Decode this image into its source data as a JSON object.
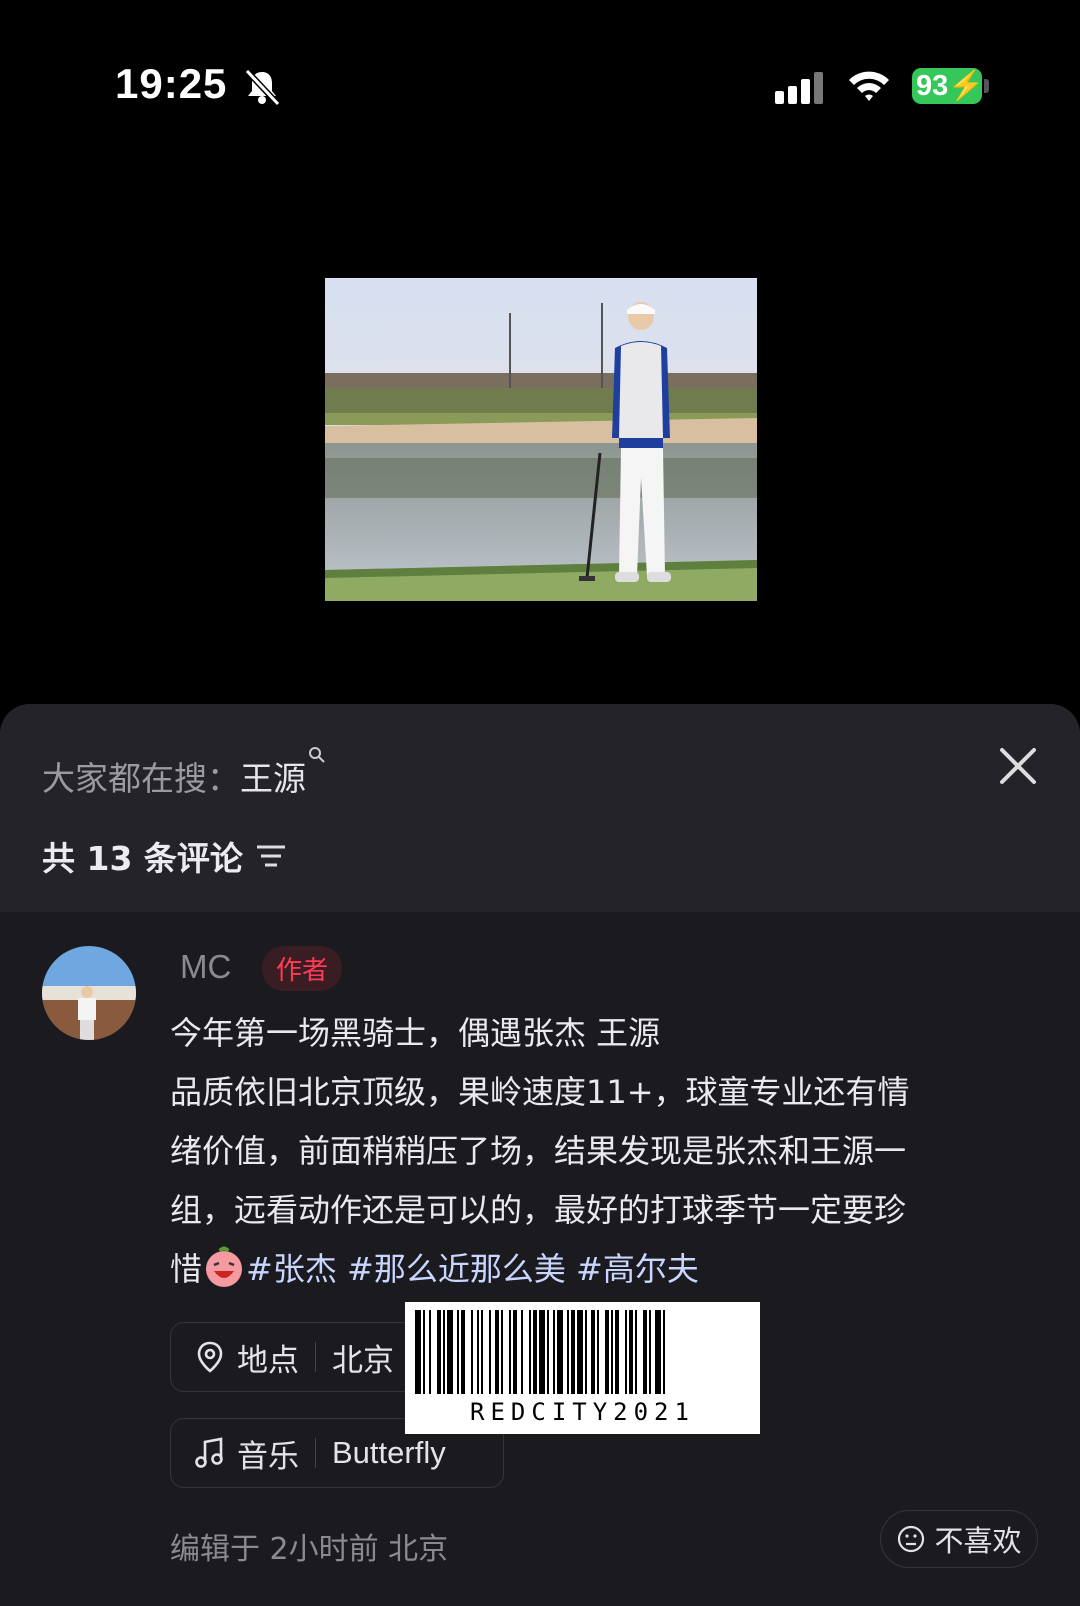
{
  "status": {
    "time": "19:25",
    "battery": "93"
  },
  "search": {
    "prefix": "大家都在搜：",
    "keyword": "王源"
  },
  "comments": {
    "title": "共 13 条评论"
  },
  "comment": {
    "author": "MC",
    "author_tag": "作者",
    "lines": [
      "今年第一场黑骑士，偶遇张杰 王源",
      "品质依旧北京顶级，果岭速度11+，球童专业还有情",
      "绪价值，前面稍稍压了场，结果发现是张杰和王源一",
      "组，远看动作还是可以的，最好的打球季节一定要珍",
      "惜"
    ],
    "hashtags": [
      "#张杰",
      "#那么近那么美",
      "#高尔夫"
    ]
  },
  "location": {
    "label": "地点",
    "value": "北京"
  },
  "music": {
    "label": "音乐",
    "value": "Butterfly"
  },
  "barcode": {
    "text": "REDCITY2021"
  },
  "footer": {
    "edited": "编辑于 2小时前 北京",
    "dislike": "不喜欢"
  },
  "colors": {
    "accent_red": "#ff3b55",
    "battery_green": "#35c759",
    "sheet_bg": "#1b1b1f"
  }
}
